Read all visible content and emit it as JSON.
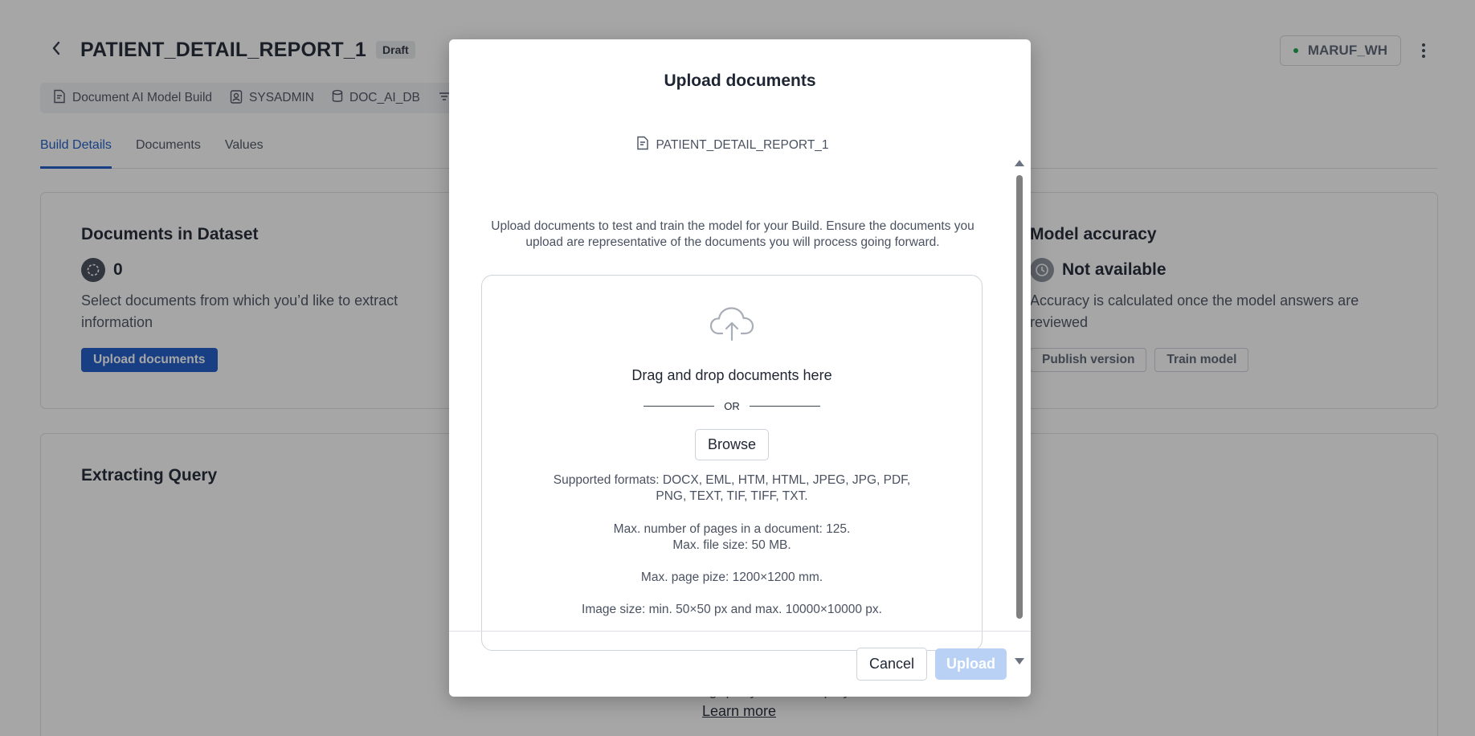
{
  "page": {
    "title": "PATIENT_DETAIL_REPORT_1",
    "status_badge": "Draft",
    "warehouse": "MARUF_WH",
    "meta": {
      "build_type": "Document AI Model Build",
      "role": "SYSADMIN",
      "database": "DOC_AI_DB"
    },
    "tabs": [
      "Build Details",
      "Documents",
      "Values"
    ],
    "documents_card": {
      "title": "Documents in Dataset",
      "count": "0",
      "description": "Select documents from which you’d like to extract information",
      "button": "Upload documents"
    },
    "accuracy_card": {
      "title": "Model accuracy",
      "status": "Not available",
      "description": "Accuracy is calculated once the model answers are reviewed",
      "publish_button": "Publish version",
      "train_button": "Train model"
    },
    "extracting_card": {
      "title": "Extracting Query",
      "footer_text": "Most recent extracting query will be displayed here.",
      "learn_more": "Learn more"
    }
  },
  "modal": {
    "title": "Upload documents",
    "build_name": "PATIENT_DETAIL_REPORT_1",
    "intro": "Upload documents to test and train the model for your Build. Ensure the documents you upload are representative of the documents you will process going forward.",
    "dropzone": {
      "title": "Drag and drop documents here",
      "or": "OR",
      "browse": "Browse",
      "formats": "Supported formats: DOCX, EML, HTM, HTML, JPEG, JPG, PDF, PNG, TEXT, TIF, TIFF, TXT.",
      "max_pages": "Max. number of pages in a document: 125.",
      "max_file_size": "Max. file size: 50 MB.",
      "max_page_size": "Max. page pize: 1200×1200 mm.",
      "image_size": "Image size: min. 50×50 px and max. 10000×10000 px."
    },
    "cancel": "Cancel",
    "upload": "Upload"
  },
  "colors": {
    "accent": "#1a5ac8",
    "upload_disabled": "#b8d1f5",
    "overlay": "rgba(20,20,20,0.38)"
  }
}
